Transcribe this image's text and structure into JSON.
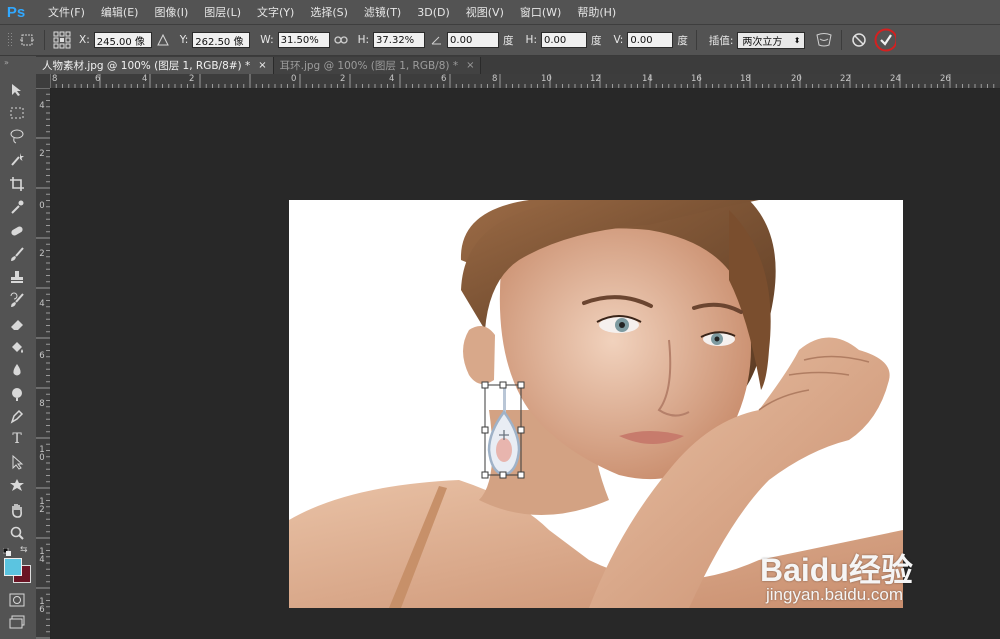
{
  "app": {
    "logo": "Ps"
  },
  "menu": [
    "文件(F)",
    "编辑(E)",
    "图像(I)",
    "图层(L)",
    "文字(Y)",
    "选择(S)",
    "滤镜(T)",
    "3D(D)",
    "视图(V)",
    "窗口(W)",
    "帮助(H)"
  ],
  "options": {
    "x_label": "X:",
    "x_value": "245.00 像",
    "y_label": "Y:",
    "y_value": "262.50 像",
    "w_label": "W:",
    "w_value": "31.50%",
    "h_label": "H:",
    "h_value": "37.32%",
    "angle_value": "0.00",
    "angle_unit": "度",
    "hskew_label": "H:",
    "hskew_value": "0.00",
    "hskew_unit": "度",
    "vskew_label": "V:",
    "vskew_value": "0.00",
    "vskew_unit": "度",
    "interp_label": "插值:",
    "interp_value": "两次立方",
    "commit_highlight_color": "#d42020"
  },
  "tabs": [
    {
      "label": "人物素材.jpg @ 100% (图层 1, RGB/8#) *",
      "close": "×",
      "active": true
    },
    {
      "label": "耳环.jpg @ 100% (图层 1, RGB/8) *",
      "close": "×",
      "active": false
    }
  ],
  "ruler_h": [
    "8",
    "6",
    "4",
    "2",
    "0",
    "2",
    "4",
    "6",
    "8",
    "10",
    "12",
    "14",
    "16",
    "18",
    "20",
    "22",
    "24",
    "26"
  ],
  "ruler_v": [
    "4",
    "2",
    "0",
    "2",
    "4",
    "6",
    "8",
    "10",
    "12",
    "14",
    "16"
  ],
  "tools": [
    "move-tool",
    "marquee-tool",
    "lasso-tool",
    "quick-select-tool",
    "crop-tool",
    "eyedropper-tool",
    "healing-brush-tool",
    "brush-tool",
    "clone-stamp-tool",
    "history-brush-tool",
    "eraser-tool",
    "paint-bucket-tool",
    "blur-tool",
    "dodge-tool",
    "pen-tool",
    "type-tool",
    "path-select-tool",
    "shape-tool",
    "hand-tool",
    "zoom-tool"
  ],
  "type_tool_glyph": "T",
  "colors": {
    "foreground": "#5bc4e0",
    "background": "#6a1424",
    "accent": "#31a8ff"
  },
  "watermark": {
    "brand": "Baidu经验",
    "url": "jingyan.baidu.com"
  }
}
